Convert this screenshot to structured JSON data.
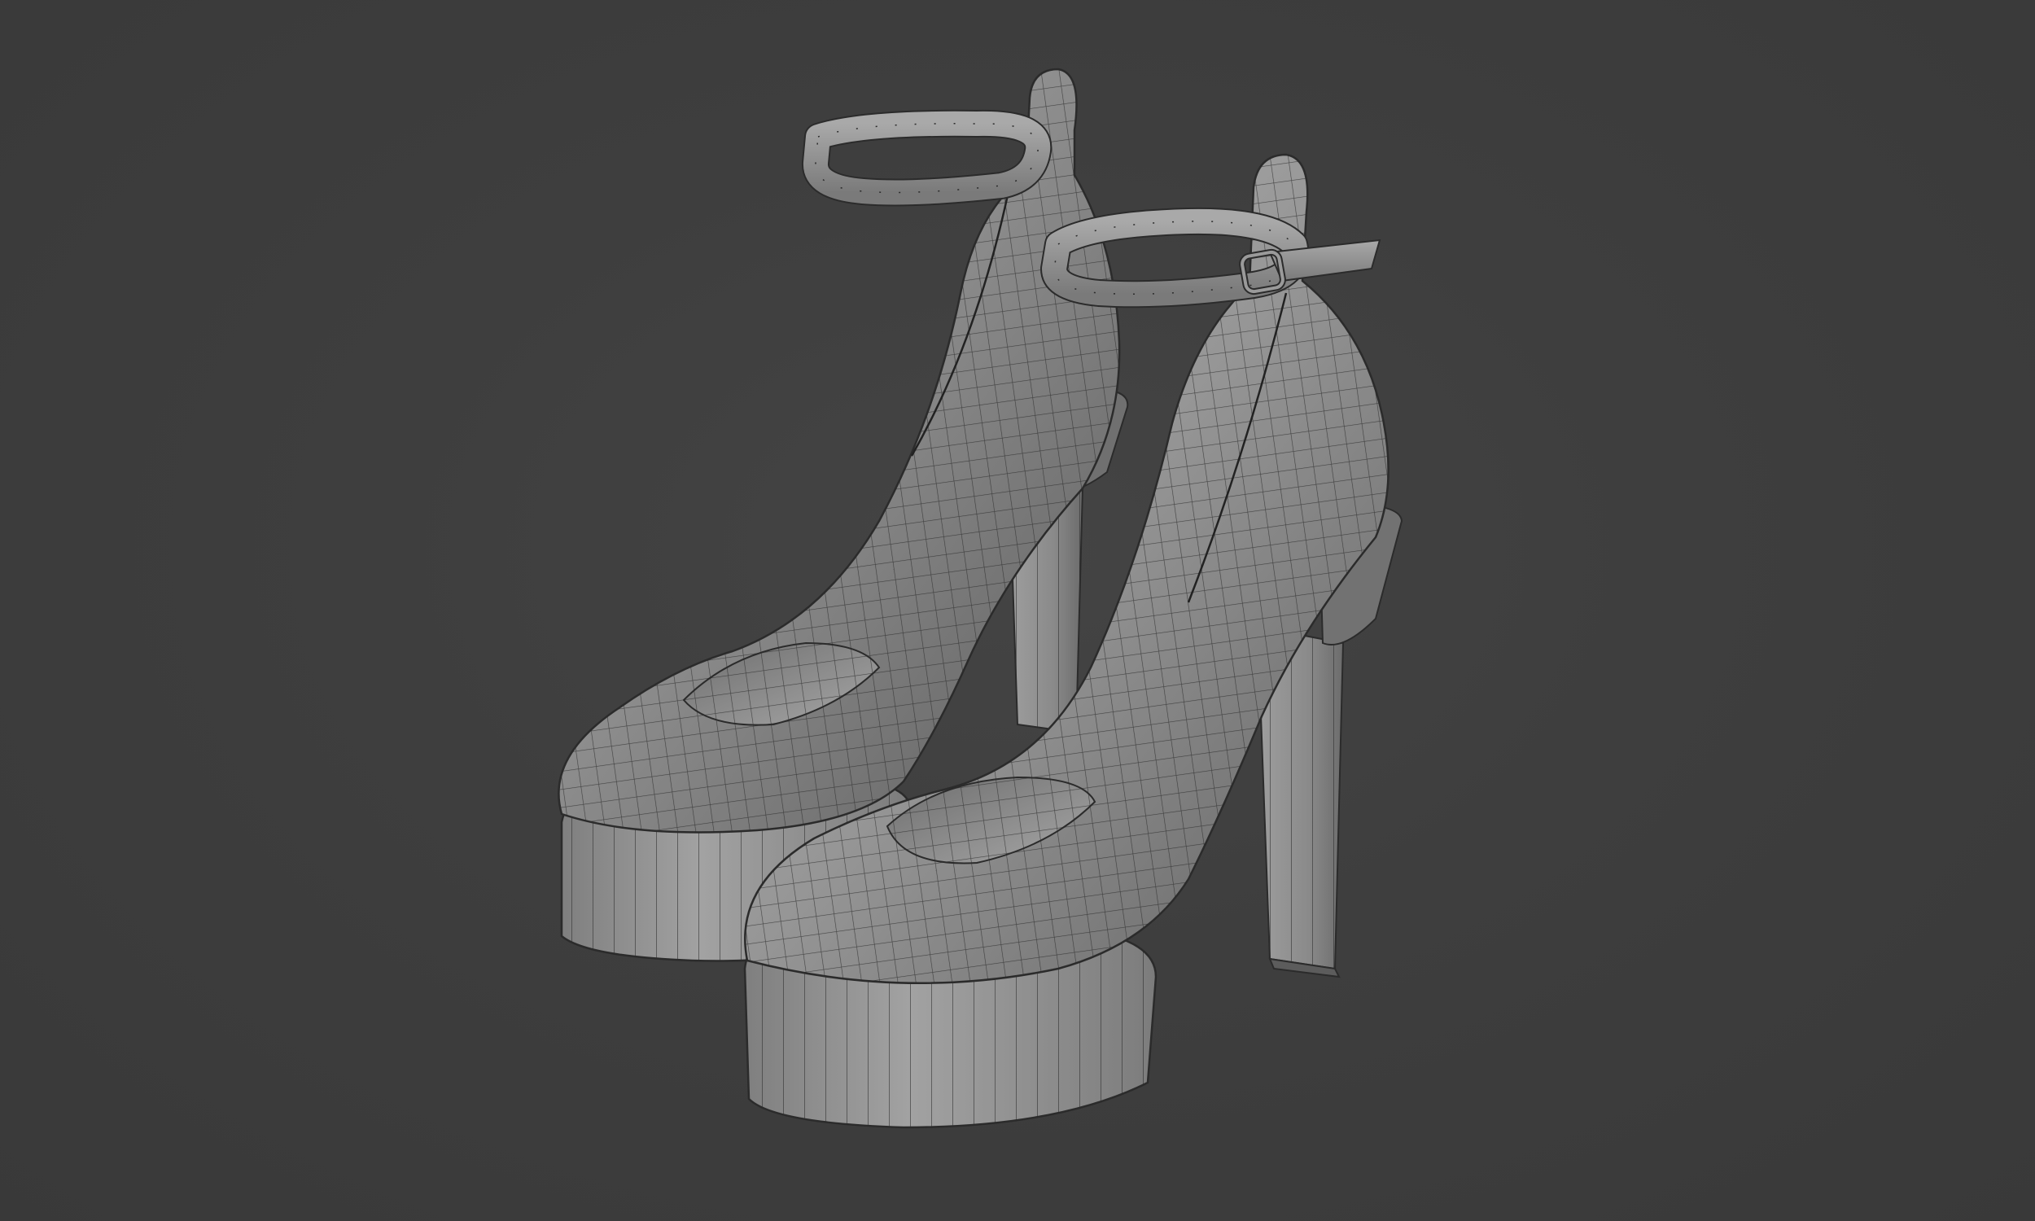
{
  "viewport": {
    "background_color": "#3d3d3d",
    "object_fill": "#8a8a8a",
    "object_fill_dark": "#5a5a5a",
    "object_fill_light": "#b4b4b4",
    "wire_color": "#2b2b2b"
  },
  "scene": {
    "objects": [
      {
        "name": "left-shoe",
        "type": "platform-pump-with-ankle-strap"
      },
      {
        "name": "right-shoe",
        "type": "platform-pump-with-ankle-strap"
      }
    ]
  }
}
